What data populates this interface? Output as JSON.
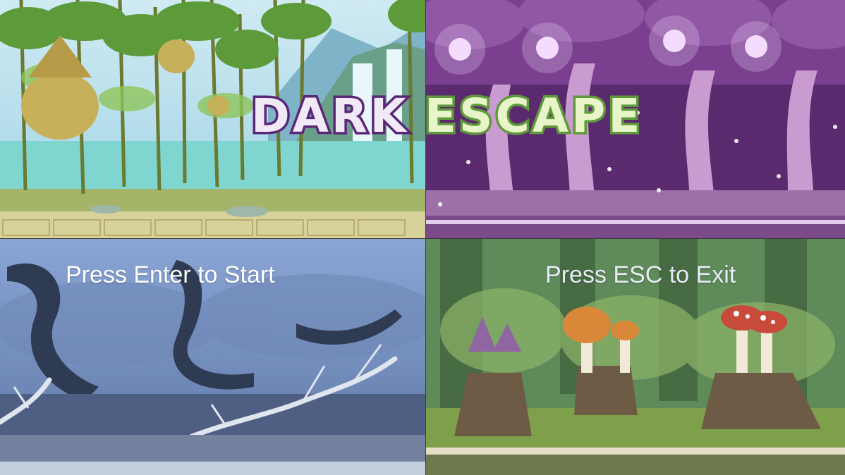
{
  "title": {
    "word1": "DARK",
    "word2": "ESCAPE"
  },
  "prompts": {
    "start": "Press Enter to Start",
    "exit": "Press ESC to Exit"
  },
  "panels": [
    {
      "name": "jungle-waterfall-scene",
      "palette": {
        "sky": "#9fd3e6",
        "water": "#7fd6d0",
        "ground": "#c9c58e",
        "foliage": "#5c9a3a"
      }
    },
    {
      "name": "purple-enchanted-forest-scene",
      "palette": {
        "sky": "#5b2a6e",
        "tree": "#c99bd0",
        "glow": "#f4dcff",
        "ground": "#7b4a88"
      }
    },
    {
      "name": "dead-swamp-scene",
      "palette": {
        "sky": "#7d97c8",
        "tree": "#2f3b52",
        "ground": "#5a6c90",
        "roots": "#dfe6ef"
      }
    },
    {
      "name": "mushroom-forest-scene",
      "palette": {
        "sky": "#5f8a5a",
        "ground": "#7ea04a",
        "mushroom": "#c84a3a",
        "stump": "#6d5b46"
      }
    }
  ]
}
